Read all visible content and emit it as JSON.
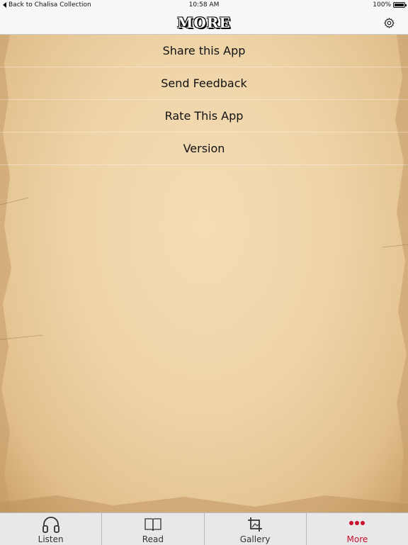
{
  "status": {
    "back_label": "Back to Chalisa Collection",
    "time": "10:58 AM",
    "battery": "100%"
  },
  "nav": {
    "title": "MORE"
  },
  "menu": {
    "items": [
      {
        "label": "Share this App"
      },
      {
        "label": "Send Feedback"
      },
      {
        "label": "Rate This App"
      },
      {
        "label": "Version"
      }
    ]
  },
  "tabs": [
    {
      "label": "Listen",
      "icon": "headphones-icon"
    },
    {
      "label": "Read",
      "icon": "book-icon"
    },
    {
      "label": "Gallery",
      "icon": "crop-icon"
    },
    {
      "label": "More",
      "icon": "more-dots-icon"
    }
  ],
  "colors": {
    "active_tab": "#c8102e",
    "bar_background": "#f7f7f7"
  }
}
